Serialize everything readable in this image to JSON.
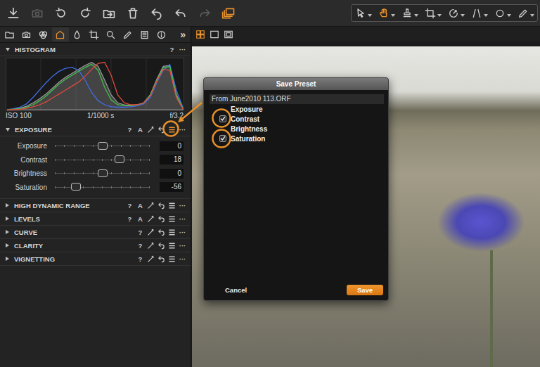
{
  "toolbar": {
    "actions": [
      {
        "disabled": false,
        "active": false
      },
      {
        "disabled": true,
        "active": false
      },
      {
        "disabled": false,
        "active": false
      },
      {
        "disabled": false,
        "active": false
      },
      {
        "disabled": false,
        "active": false
      },
      {
        "disabled": false,
        "active": false
      },
      {
        "disabled": false,
        "active": false
      },
      {
        "disabled": false,
        "active": false
      },
      {
        "disabled": true,
        "active": false
      },
      {
        "disabled": false,
        "active": true
      }
    ],
    "tools": [
      {
        "selected": false
      },
      {
        "selected": true
      },
      {
        "selected": false
      },
      {
        "selected": false
      },
      {
        "selected": false
      },
      {
        "selected": false
      },
      {
        "selected": false
      },
      {
        "selected": false
      }
    ]
  },
  "tool_tabs": {
    "tabs": [
      {
        "selected": false
      },
      {
        "selected": false
      },
      {
        "selected": false
      },
      {
        "selected": true
      },
      {
        "selected": false
      },
      {
        "selected": false
      },
      {
        "selected": false
      },
      {
        "selected": false
      },
      {
        "selected": false
      },
      {
        "selected": false
      }
    ],
    "overflow": "»"
  },
  "viewer_modes": [
    {
      "selected": true
    },
    {
      "selected": false
    },
    {
      "selected": false
    }
  ],
  "histogram": {
    "title": "HISTOGRAM",
    "help": "?",
    "more": "···",
    "series": [
      {
        "kind": "area",
        "color": "#9a9a9a",
        "values": [
          0,
          1,
          3,
          7,
          14,
          22,
          32,
          44,
          56,
          66,
          74,
          82,
          90,
          96,
          88,
          60,
          30,
          14,
          10,
          9,
          10,
          14,
          30,
          62,
          88,
          90,
          32,
          3
        ]
      },
      {
        "kind": "line",
        "color": "#3f6ee8",
        "values": [
          0,
          2,
          5,
          12,
          25,
          40,
          55,
          68,
          78,
          84,
          86,
          80,
          60,
          35,
          18,
          10,
          6,
          5,
          5,
          6,
          8,
          12,
          25,
          55,
          80,
          92,
          40,
          5
        ]
      },
      {
        "kind": "line",
        "color": "#3fbf4a",
        "values": [
          0,
          1,
          2,
          5,
          10,
          18,
          28,
          40,
          52,
          62,
          70,
          78,
          86,
          92,
          80,
          45,
          20,
          10,
          8,
          8,
          10,
          14,
          30,
          60,
          85,
          88,
          30,
          3
        ]
      },
      {
        "kind": "line",
        "color": "#e04a3a",
        "values": [
          0,
          0,
          1,
          3,
          6,
          10,
          16,
          24,
          32,
          40,
          48,
          56,
          68,
          82,
          94,
          96,
          70,
          30,
          14,
          10,
          10,
          14,
          28,
          58,
          82,
          80,
          25,
          2
        ]
      }
    ],
    "exif": {
      "iso": "ISO 100",
      "shutter": "1/1000 s",
      "aperture": "f/3.2"
    }
  },
  "sections": [
    {
      "title": "EXPOSURE",
      "expanded": true,
      "help": "?",
      "auto": "A",
      "more": "···",
      "highlighted": true,
      "sliders": [
        {
          "label": "Exposure",
          "value": "0",
          "level": 0.5
        },
        {
          "label": "Contrast",
          "value": "18",
          "level": 0.68
        },
        {
          "label": "Brightness",
          "value": "0",
          "level": 0.5
        },
        {
          "label": "Saturation",
          "value": "-56",
          "level": 0.22
        }
      ]
    },
    {
      "title": "HIGH DYNAMIC RANGE",
      "expanded": false,
      "help": "?",
      "auto": "A",
      "more": "···",
      "highlighted": false,
      "sliders": []
    },
    {
      "title": "LEVELS",
      "expanded": false,
      "help": "?",
      "auto": "A",
      "more": "···",
      "highlighted": false,
      "sliders": []
    },
    {
      "title": "CURVE",
      "expanded": false,
      "help": "?",
      "auto": "",
      "more": "···",
      "highlighted": false,
      "sliders": []
    },
    {
      "title": "CLARITY",
      "expanded": false,
      "help": "?",
      "auto": "",
      "more": "···",
      "highlighted": false,
      "sliders": []
    },
    {
      "title": "VIGNETTING",
      "expanded": false,
      "help": "?",
      "auto": "",
      "more": "···",
      "highlighted": false,
      "sliders": []
    }
  ],
  "dialog": {
    "title": "Save Preset",
    "source": "From June2010 113.ORF",
    "items": [
      {
        "label": "Exposure",
        "kind": "label",
        "checked": false
      },
      {
        "label": "Contrast",
        "kind": "checkbox",
        "checked": true
      },
      {
        "label": "Brightness",
        "kind": "label",
        "checked": false
      },
      {
        "label": "Saturation",
        "kind": "checkbox",
        "checked": true
      }
    ],
    "buttons": [
      {
        "label": "Cancel",
        "primary": false
      },
      {
        "label": "Save",
        "primary": true
      }
    ]
  }
}
